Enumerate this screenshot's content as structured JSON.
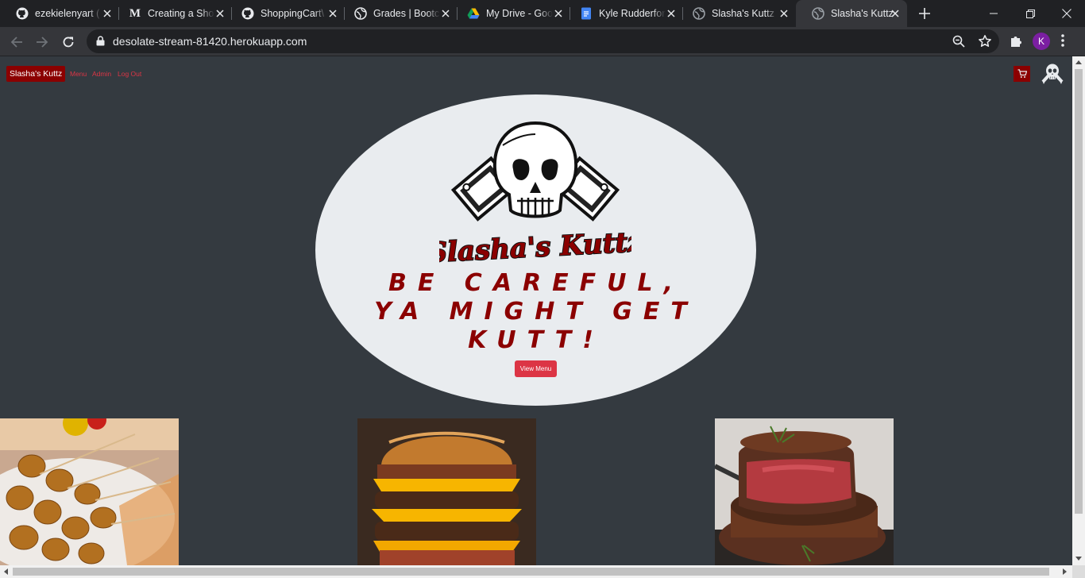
{
  "browser": {
    "tabs": [
      {
        "title": "ezekielenyart (",
        "icon": "github-icon"
      },
      {
        "title": "Creating a Sho",
        "icon": "medium-icon"
      },
      {
        "title": "ShoppingCart\\",
        "icon": "github-icon"
      },
      {
        "title": "Grades | Bootc",
        "icon": "globe-icon"
      },
      {
        "title": "My Drive - Goo",
        "icon": "google-drive-icon"
      },
      {
        "title": "Kyle Rudderfor",
        "icon": "google-docs-icon"
      },
      {
        "title": "Slasha's Kuttz",
        "icon": "globe-icon"
      },
      {
        "title": "Slasha's Kuttz",
        "icon": "globe-icon",
        "active": true
      }
    ],
    "url": "desolate-stream-81420.herokuapp.com",
    "profile_initial": "K"
  },
  "site": {
    "brand": "Slasha's Kuttz",
    "nav": {
      "menu": "Menu",
      "admin": "Admin",
      "logout": "Log Out"
    },
    "logo_text": "Slasha's Kuttz",
    "tagline": [
      "BE CAREFUL,",
      "YA MIGHT GET",
      "KUTT!"
    ],
    "view_menu_label": "View Menu"
  },
  "food_images": [
    "corn-dogs-image",
    "bacon-cheeseburger-image",
    "filet-steak-image"
  ],
  "colors": {
    "page_bg": "#343a40",
    "oval_bg": "#e9ecef",
    "brand_red": "#8b0000",
    "accent_red": "#dc3545",
    "chrome_dark": "#202124",
    "chrome_toolbar": "#35363a"
  }
}
